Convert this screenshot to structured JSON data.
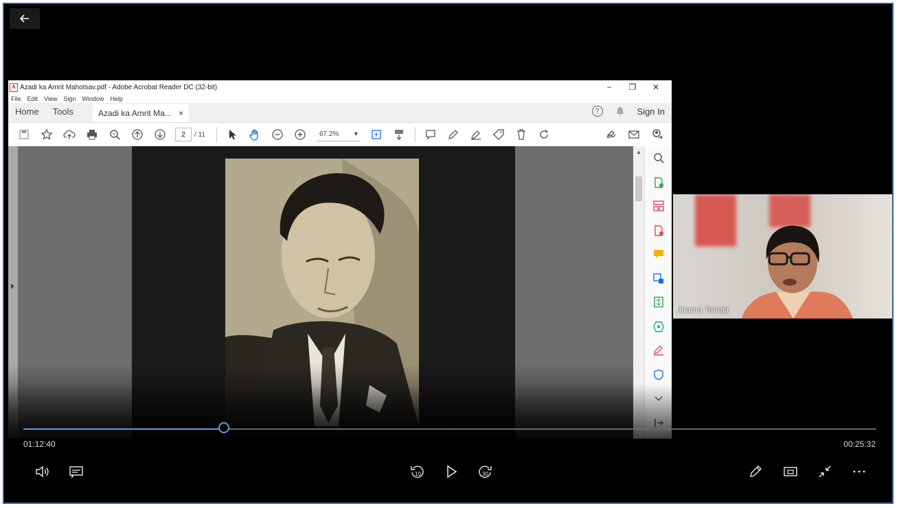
{
  "acrobat": {
    "window_title": "Azadi ka Amrit Mahotsav.pdf - Adobe Acrobat Reader DC (32-bit)",
    "menu": [
      "File",
      "Edit",
      "View",
      "Sign",
      "Window",
      "Help"
    ],
    "tabs": {
      "home": "Home",
      "tools": "Tools",
      "doc": "Azadi ka Amrit Ma...",
      "doc_close": "×"
    },
    "sign_in": "Sign In",
    "help_symbol": "?",
    "page_current": "2",
    "page_total": "/ 11",
    "zoom": "67.2%"
  },
  "participant": {
    "name": "Jharna Taneja"
  },
  "player": {
    "time_elapsed": "01:12:40",
    "time_remaining": "00:25:32",
    "progress": 0.235,
    "rewind_label": "10",
    "forward_label": "30"
  },
  "colors": {
    "accent": "#5aa0e0",
    "frame_border": "#3a5da8",
    "acrobat_red": "#c0392b",
    "acrobat_pink": "#e0427a"
  }
}
